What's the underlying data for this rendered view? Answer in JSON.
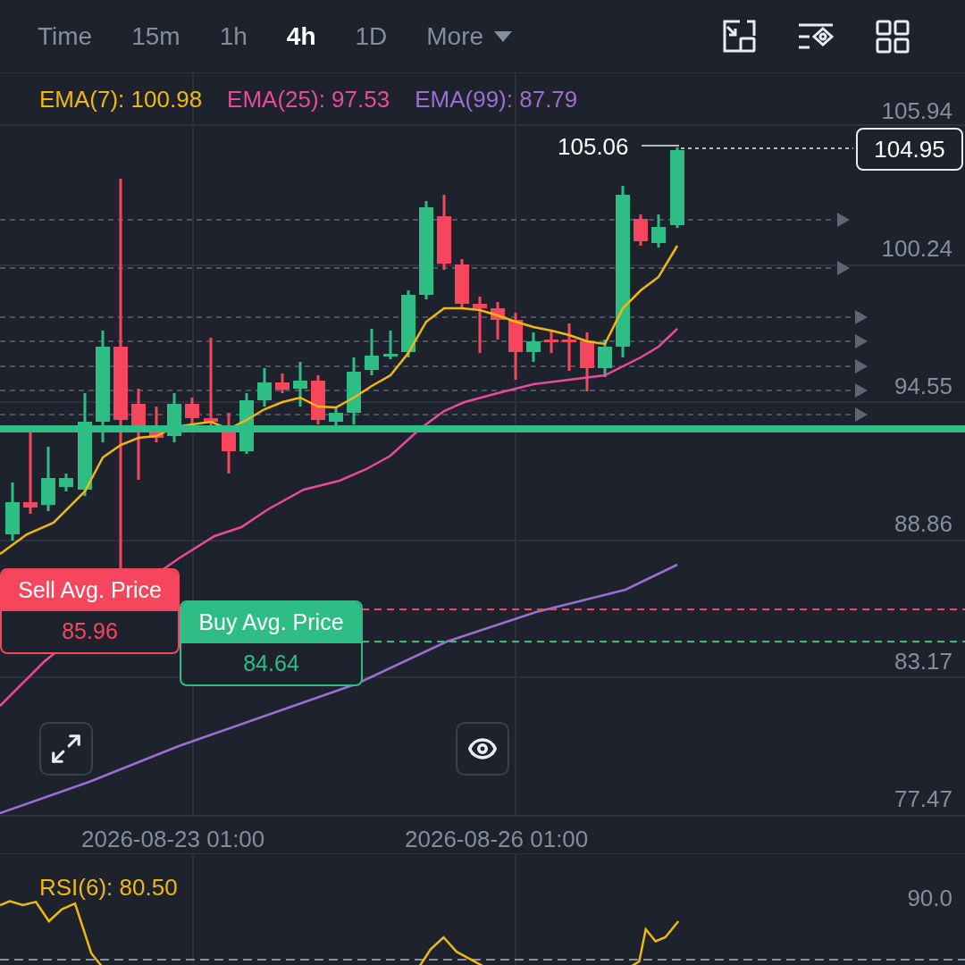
{
  "timeframe_tabs": [
    {
      "label": "Time",
      "kind": "tab",
      "selected": false
    },
    {
      "label": "15m",
      "kind": "tab",
      "selected": false
    },
    {
      "label": "1h",
      "kind": "tab",
      "selected": false
    },
    {
      "label": "4h",
      "kind": "tab",
      "selected": true
    },
    {
      "label": "1D",
      "kind": "tab",
      "selected": false
    },
    {
      "label": "More",
      "kind": "dropdown",
      "selected": false
    }
  ],
  "indicators": [
    {
      "label": "EMA(7): 100.98",
      "color": "#f0b90b"
    },
    {
      "label": "EMA(25): 97.53",
      "color": "#e84b9c"
    },
    {
      "label": "EMA(99): 87.79",
      "color": "#9a6fd0"
    }
  ],
  "price_axis": [
    "105.94",
    "100.24",
    "94.55",
    "88.86",
    "83.17",
    "77.47"
  ],
  "high_label": "105.06",
  "last_price": "104.95",
  "sell_avg": {
    "title": "Sell Avg. Price",
    "value": "85.96"
  },
  "buy_avg": {
    "title": "Buy Avg. Price",
    "value": "84.64"
  },
  "time_axis": [
    "2026-08-23 01:00",
    "2026-08-26 01:00"
  ],
  "rsi": {
    "label": "RSI(6): 80.50",
    "axis": [
      "90.0"
    ]
  }
}
